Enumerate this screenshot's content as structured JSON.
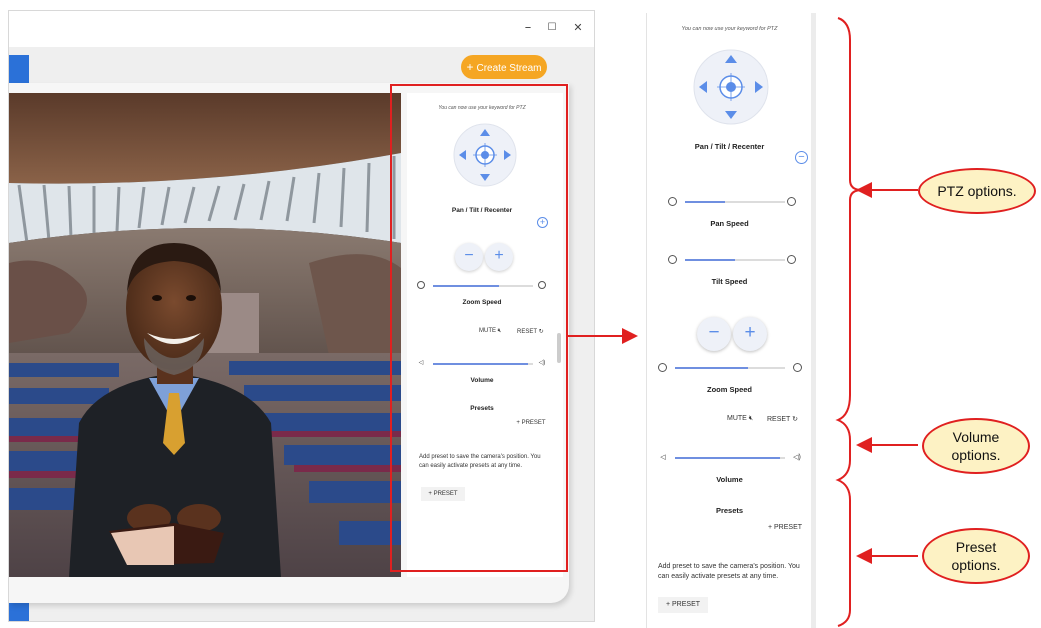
{
  "window": {
    "minimize_glyph": "–",
    "maximize_glyph": "☐",
    "close_glyph": "✕",
    "create_stream_label": "Create Stream",
    "create_stream_icon": "+"
  },
  "panel": {
    "hint": "You can now use your keyword for PTZ",
    "pan_tilt_label": "Pan / Tilt / Recenter",
    "pan_speed_label": "Pan Speed",
    "tilt_speed_label": "Tilt Speed",
    "zoom_speed_label": "Zoom Speed",
    "mute_label": "MUTE",
    "reset_label": "RESET",
    "volume_label": "Volume",
    "presets_label": "Presets",
    "add_preset_label": "+ PRESET",
    "preset_help": "Add preset to save the camera's position. You can easily activate presets at any time.",
    "preset_button_label": "+ PRESET",
    "zoom_out_glyph": "−",
    "zoom_in_glyph": "+",
    "collapse_glyph": "−",
    "expand_glyph": "+",
    "zoom_speed_level": 0.66,
    "pan_speed_level": 0.4,
    "tilt_speed_level": 0.5,
    "volume_level": 0.95
  },
  "callouts": {
    "ptz": "PTZ options.",
    "volume": "Volume options.",
    "preset": "Preset options."
  },
  "colors": {
    "accent": "#f5a623",
    "brand_blue": "#2b71d8",
    "highlight_red": "#e02020",
    "callout_fill": "#fdf2c4"
  }
}
